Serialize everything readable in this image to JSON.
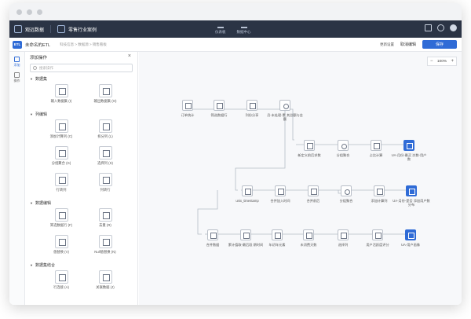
{
  "app": {
    "brand": "观远数据",
    "workspace": "零售行业案例",
    "center_tabs": [
      "仪表板",
      "数据中心"
    ]
  },
  "subbar": {
    "badge": "ETL",
    "name": "未命名的ETL",
    "breadcrumb": "科技信息 > 数据源 > 销售看板",
    "update_settings": "更新设置",
    "cancel": "取消编辑",
    "save": "保存"
  },
  "rail": {
    "add": "添加",
    "ops": "操作"
  },
  "panel": {
    "title": "添加操作",
    "search_placeholder": "搜索操作",
    "sections": [
      {
        "title": "数据集",
        "items": [
          "输入数据集 (I)",
          "输出数据集 (O)"
        ]
      },
      {
        "title": "列编辑",
        "items": [
          "添加计算列 (C)",
          "拆分列 (L)",
          "分组聚合 (G)",
          "选择列 (S)",
          "行转列",
          "列转行"
        ]
      },
      {
        "title": "数据编辑",
        "items": [
          "筛选数据行 (F)",
          "去重 (R)",
          "值替换 (V)",
          "Null值替换 (N)"
        ]
      },
      {
        "title": "数据集结合",
        "items": [
          "行连接 (A)",
          "关联数据 (J)"
        ]
      }
    ]
  },
  "canvas": {
    "zoom": "100%",
    "nodes": [
      "订单统计",
      "筛选数据行",
      "列份分享",
      "月-未处理-累\n其总额与金额",
      "新定义前后求数",
      "分组聚合",
      "占比计算",
      "UA-月份-最买\n次数-用户数",
      "unix_timestamp",
      "合并加入时间",
      "合并前后",
      "分组聚合",
      "添加计算列",
      "UA-月份-是否\n添加用户数分布",
      "合并数据",
      "累计值取-最后段\n期时间",
      "年初年元素",
      "未消费天数",
      "选择列",
      "用户活跃度评分",
      "UA-用户画像"
    ]
  }
}
